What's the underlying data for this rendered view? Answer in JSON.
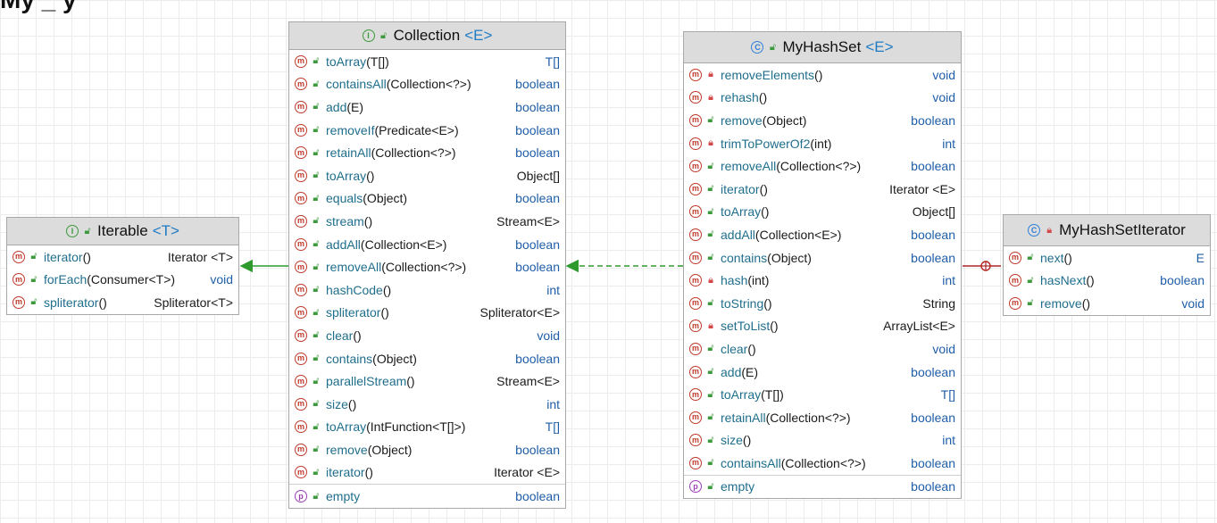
{
  "title_fragment": "My               _            y",
  "classes": {
    "iterable": {
      "kind": "I",
      "name": "Iterable",
      "generic": "<T>",
      "members": [
        {
          "kind": "m",
          "name": "iterator",
          "params": "()",
          "type": "Iterator <T>"
        },
        {
          "kind": "m",
          "name": "forEach",
          "params": "(Consumer<T>)",
          "type": "void"
        },
        {
          "kind": "m",
          "name": "spliterator",
          "params": "()",
          "type": "Spliterator<T>"
        }
      ]
    },
    "collection": {
      "kind": "I",
      "name": "Collection",
      "generic": "<E>",
      "members": [
        {
          "kind": "m",
          "name": "toArray",
          "params": "(T[])",
          "type": "T[]"
        },
        {
          "kind": "m",
          "name": "containsAll",
          "params": "(Collection<?>)",
          "type": "boolean"
        },
        {
          "kind": "m",
          "name": "add",
          "params": "(E)",
          "type": "boolean"
        },
        {
          "kind": "m",
          "name": "removeIf",
          "params": "(Predicate<E>)",
          "type": "boolean"
        },
        {
          "kind": "m",
          "name": "retainAll",
          "params": "(Collection<?>)",
          "type": "boolean"
        },
        {
          "kind": "m",
          "name": "toArray",
          "params": "()",
          "type": "Object[]"
        },
        {
          "kind": "m",
          "name": "equals",
          "params": "(Object)",
          "type": "boolean"
        },
        {
          "kind": "m",
          "name": "stream",
          "params": "()",
          "type": "Stream<E>"
        },
        {
          "kind": "m",
          "name": "addAll",
          "params": "(Collection<E>)",
          "type": "boolean"
        },
        {
          "kind": "m",
          "name": "removeAll",
          "params": "(Collection<?>)",
          "type": "boolean"
        },
        {
          "kind": "m",
          "name": "hashCode",
          "params": "()",
          "type": "int"
        },
        {
          "kind": "m",
          "name": "spliterator",
          "params": "()",
          "type": "Spliterator<E>"
        },
        {
          "kind": "m",
          "name": "clear",
          "params": "()",
          "type": "void"
        },
        {
          "kind": "m",
          "name": "contains",
          "params": "(Object)",
          "type": "boolean"
        },
        {
          "kind": "m",
          "name": "parallelStream",
          "params": "()",
          "type": "Stream<E>"
        },
        {
          "kind": "m",
          "name": "size",
          "params": "()",
          "type": "int"
        },
        {
          "kind": "m",
          "name": "toArray",
          "params": "(IntFunction<T[]>)",
          "type": "T[]"
        },
        {
          "kind": "m",
          "name": "remove",
          "params": "(Object)",
          "type": "boolean"
        },
        {
          "kind": "m",
          "name": "iterator",
          "params": "()",
          "type": "Iterator <E>"
        },
        {
          "kind": "p",
          "name": "empty",
          "params": "",
          "type": "boolean"
        }
      ]
    },
    "myhashset": {
      "kind": "C",
      "name": "MyHashSet",
      "generic": "<E>",
      "members": [
        {
          "kind": "m",
          "vis": "private",
          "name": "removeElements",
          "params": "()",
          "type": "void"
        },
        {
          "kind": "m",
          "vis": "private",
          "name": "rehash",
          "params": "()",
          "type": "void"
        },
        {
          "kind": "m",
          "name": "remove",
          "params": "(Object)",
          "type": "boolean"
        },
        {
          "kind": "m",
          "vis": "private",
          "name": "trimToPowerOf2",
          "params": "(int)",
          "type": "int"
        },
        {
          "kind": "m",
          "name": "removeAll",
          "params": "(Collection<?>)",
          "type": "boolean"
        },
        {
          "kind": "m",
          "name": "iterator",
          "params": "()",
          "type": "Iterator <E>"
        },
        {
          "kind": "m",
          "name": "toArray",
          "params": "()",
          "type": "Object[]"
        },
        {
          "kind": "m",
          "name": "addAll",
          "params": "(Collection<E>)",
          "type": "boolean"
        },
        {
          "kind": "m",
          "name": "contains",
          "params": "(Object)",
          "type": "boolean"
        },
        {
          "kind": "m",
          "vis": "private",
          "name": "hash",
          "params": "(int)",
          "type": "int"
        },
        {
          "kind": "m",
          "name": "toString",
          "params": "()",
          "type": "String"
        },
        {
          "kind": "m",
          "vis": "private",
          "name": "setToList",
          "params": "()",
          "type": "ArrayList<E>"
        },
        {
          "kind": "m",
          "name": "clear",
          "params": "()",
          "type": "void"
        },
        {
          "kind": "m",
          "name": "add",
          "params": "(E)",
          "type": "boolean"
        },
        {
          "kind": "m",
          "name": "toArray",
          "params": "(T[])",
          "type": "T[]"
        },
        {
          "kind": "m",
          "name": "retainAll",
          "params": "(Collection<?>)",
          "type": "boolean"
        },
        {
          "kind": "m",
          "name": "size",
          "params": "()",
          "type": "int"
        },
        {
          "kind": "m",
          "name": "containsAll",
          "params": "(Collection<?>)",
          "type": "boolean"
        },
        {
          "kind": "p",
          "name": "empty",
          "params": "",
          "type": "boolean"
        }
      ]
    },
    "iteratorclass": {
      "kind": "C",
      "vis": "private",
      "name": "MyHashSetIterator",
      "generic": "",
      "members": [
        {
          "kind": "m",
          "name": "next",
          "params": "()",
          "type": "E"
        },
        {
          "kind": "m",
          "name": "hasNext",
          "params": "()",
          "type": "boolean"
        },
        {
          "kind": "m",
          "name": "remove",
          "params": "()",
          "type": "void"
        }
      ]
    }
  },
  "relations": [
    {
      "from": "Collection",
      "to": "Iterable",
      "kind": "extends"
    },
    {
      "from": "MyHashSet",
      "to": "Collection",
      "kind": "implements"
    },
    {
      "from": "MyHashSetIterator",
      "to": "MyHashSet",
      "kind": "inner-class"
    }
  ],
  "colors": {
    "extends": "#2e9a2e",
    "implements": "#2e9a2e",
    "inner": "#b02424",
    "method": "#c0392b",
    "property": "#9b3fb5",
    "interface": "#3c9a3c",
    "class": "#2f7fd8"
  }
}
